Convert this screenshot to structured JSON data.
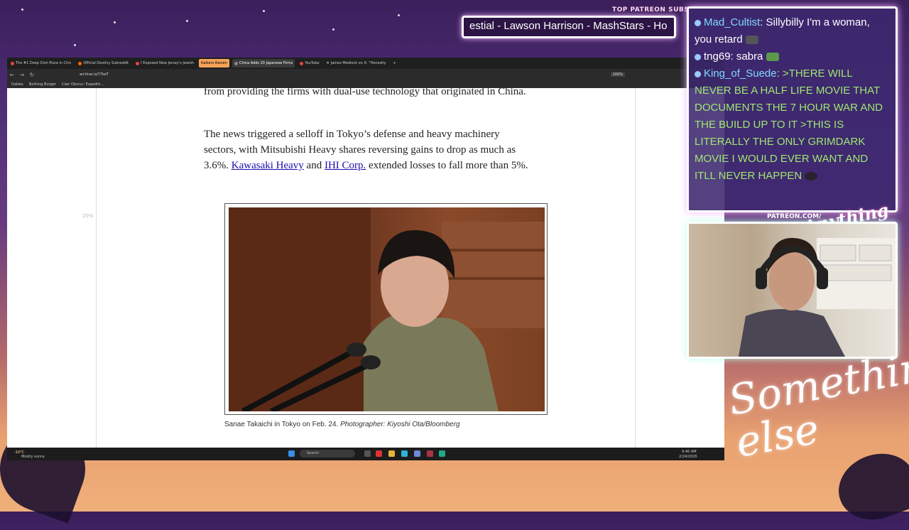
{
  "overlay": {
    "ticker_title": "TOP PATREON SUBS",
    "ticker_text": "estial - Lawson Harrison - MashStars - Ho",
    "patreon_url": "PATREON.COM/",
    "patreon_logo": "Anything else",
    "big_logo": "Something else"
  },
  "browser": {
    "tabs": [
      {
        "label": "The #1 Deep Dish Pizza in Chic"
      },
      {
        "label": "Official Destiny Subreddit"
      },
      {
        "label": "I Exposed New Jersey's Jewish"
      },
      {
        "label": "Kalkers Ravien"
      },
      {
        "label": "China Adds 20 Japanese Firms"
      },
      {
        "label": "YouTube"
      },
      {
        "label": "James Medlock on X: \"Honestly"
      }
    ],
    "url": "archive.is/Y7koT",
    "zoom": "100%",
    "bookmarks": [
      "Dailies",
      "Nothing Burger",
      "Clair Obscur: Expediti..."
    ]
  },
  "article": {
    "p1": "from providing the firms with dual-use technology that originated in China.",
    "p2_pre": "The news triggered a selloff in Tokyo’s defense and heavy machinery sectors, with Mitsubishi Heavy shares reversing gains to drop as much as 3.6%. ",
    "link1": "Kawasaki Heavy",
    "p2_mid": " and ",
    "link2": "IHI Corp.",
    "p2_post": " extended losses to fall more than 5%.",
    "caption_main": "Sanae Takaichi in Tokyo on Feb. 24. ",
    "caption_credit": "Photographer: Kiyoshi Ota/Bloomberg",
    "zoom_side": "20%"
  },
  "taskbar": {
    "weather_temp": "-10°C",
    "weather_desc": "Mostly sunny",
    "search": "Search",
    "time": "9:46 AM",
    "date": "2/24/2026"
  },
  "chat": [
    {
      "user": "Mad_Cultist",
      "user_color": "#7fd8ff",
      "text": ": Sillybilly I'm a woman, you retard"
    },
    {
      "user": "tng69",
      "user_color": "#ffffff",
      "text": ": sabra"
    },
    {
      "user": "King_of_Suede",
      "user_color": "#7fd8ff",
      "text": ": >THERE WILL NEVER BE A HALF LIFE MOVIE THAT DOCUMENTS THE 7 HOUR WAR AND THE BUILD UP TO IT >THIS IS LITERALLY THE ONLY GRIMDARK MOVIE I WOULD EVER WANT AND ITLL NEVER HAPPEN",
      "text_color": "#9fe870"
    }
  ]
}
